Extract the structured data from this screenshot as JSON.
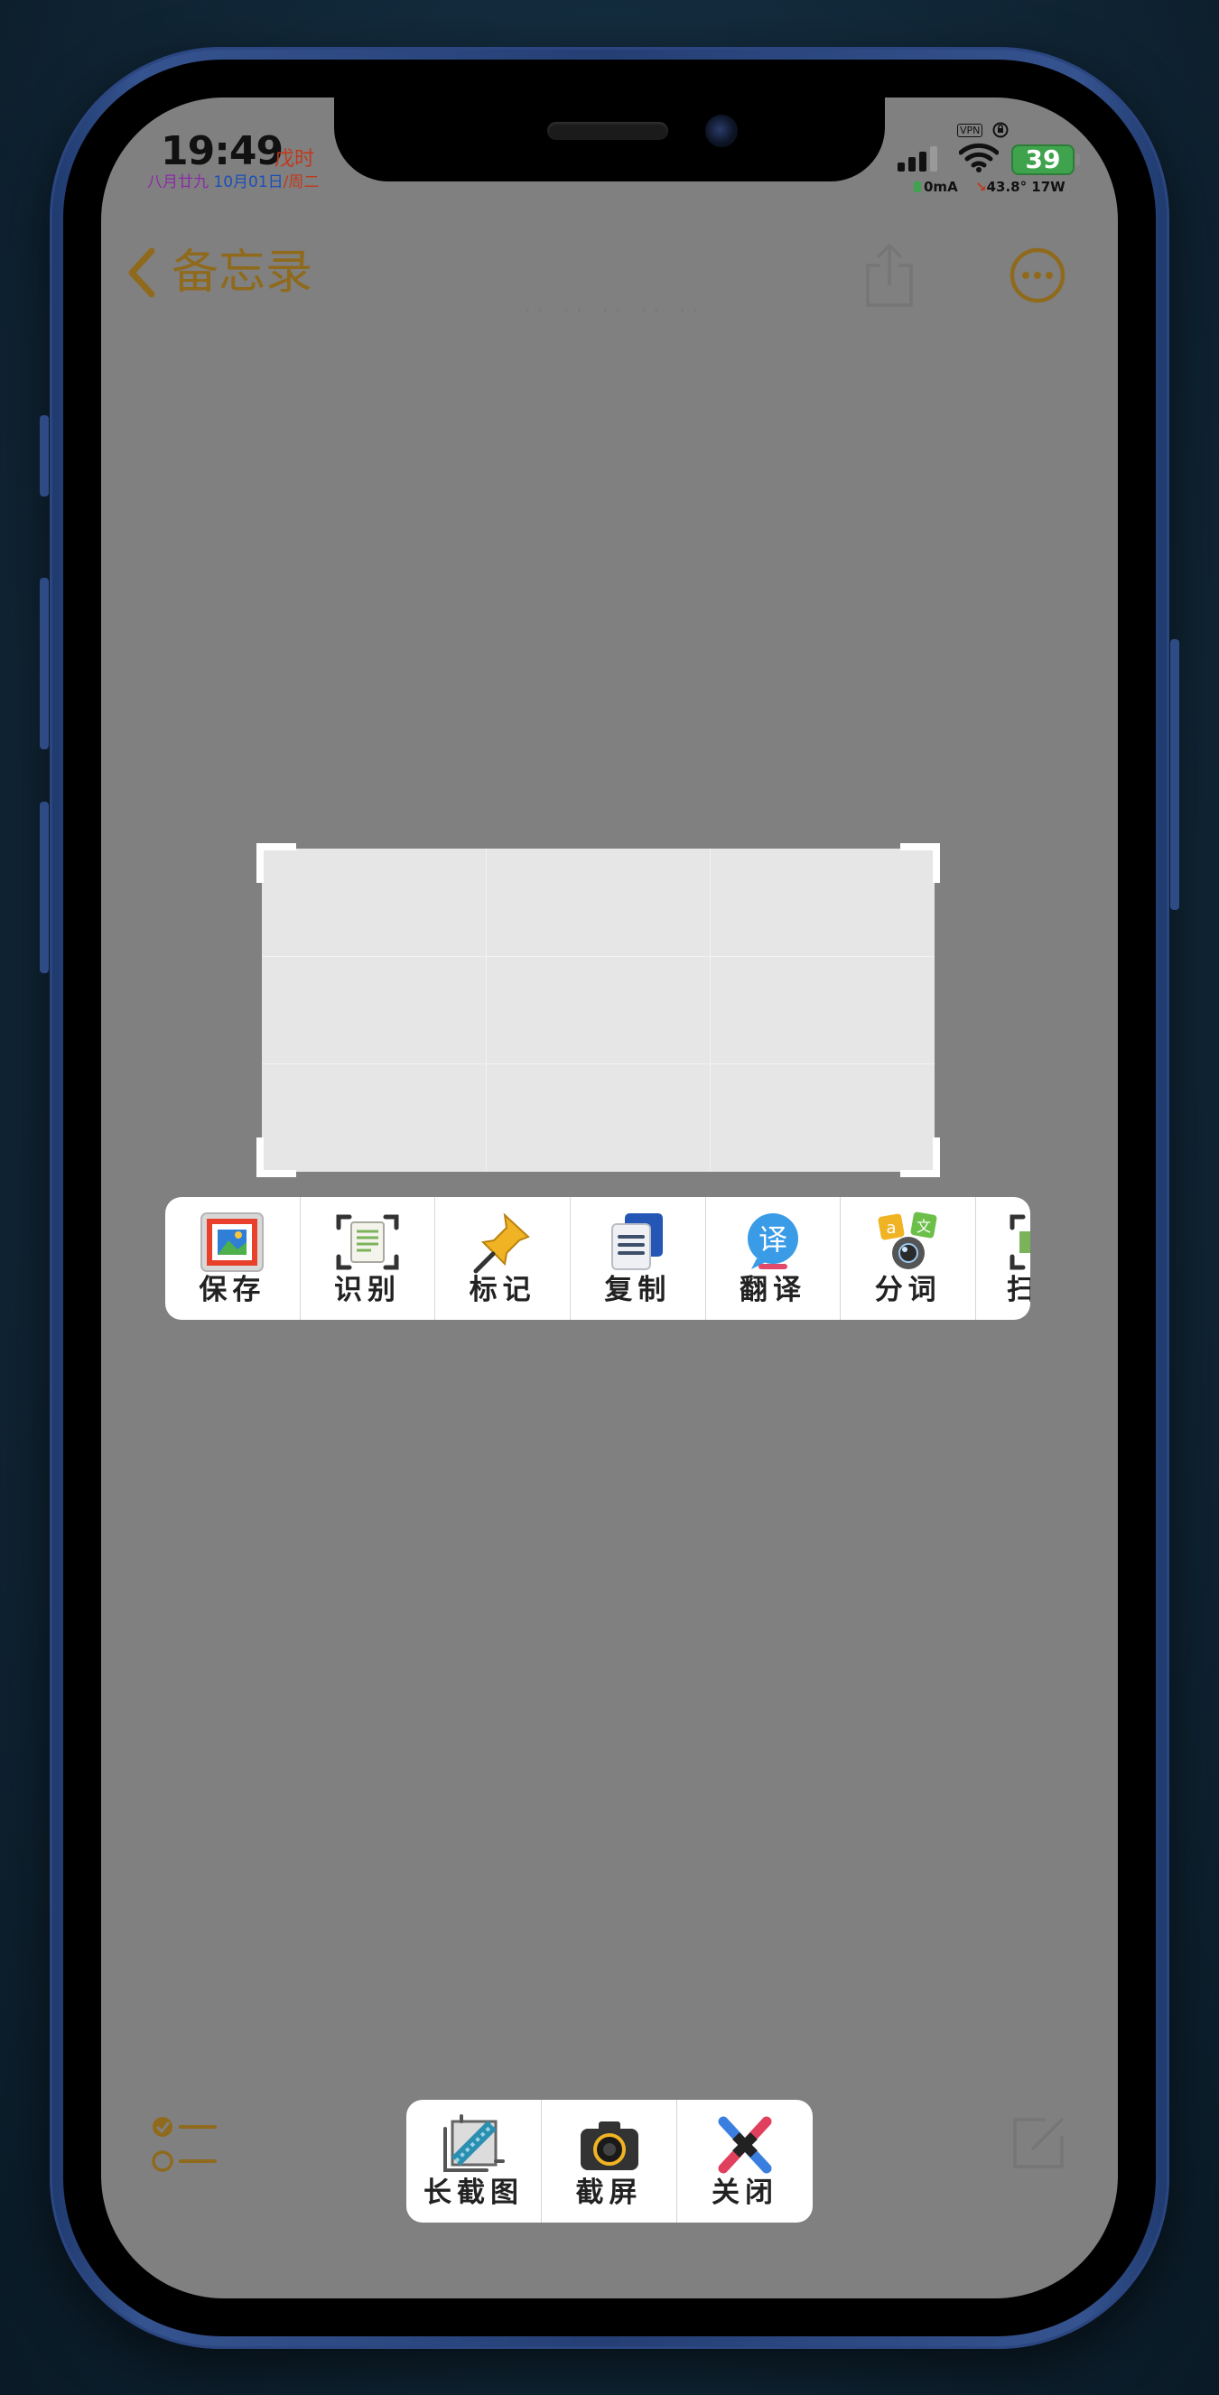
{
  "status_bar": {
    "time": "19:49",
    "shichen": "戊时",
    "lunar_date": "八月廿九",
    "date": "10月01日",
    "weekday": "/周二",
    "vpn": "VPN",
    "battery": "39",
    "current": "0mA",
    "temperature": "43.8° 17W"
  },
  "nav": {
    "back_label": "备忘录",
    "faint_title": "·· ·· ·· ·· ··"
  },
  "selection_toolbar": {
    "items": [
      {
        "label": "保存",
        "icon": "save-photo-icon"
      },
      {
        "label": "识别",
        "icon": "scan-text-icon"
      },
      {
        "label": "标记",
        "icon": "pin-icon"
      },
      {
        "label": "复制",
        "icon": "copy-document-icon"
      },
      {
        "label": "翻译",
        "icon": "translate-icon"
      },
      {
        "label": "分词",
        "icon": "segment-words-icon"
      },
      {
        "label": "扫",
        "icon": "scan-icon"
      }
    ]
  },
  "bottom_toolbar": {
    "items": [
      {
        "label": "长截图",
        "icon": "long-screenshot-icon"
      },
      {
        "label": "截屏",
        "icon": "camera-icon"
      },
      {
        "label": "关闭",
        "icon": "close-icon"
      }
    ]
  },
  "colors": {
    "accent": "#8f6a1c",
    "screen_dim": "#808080",
    "frame": "#2b4680"
  }
}
